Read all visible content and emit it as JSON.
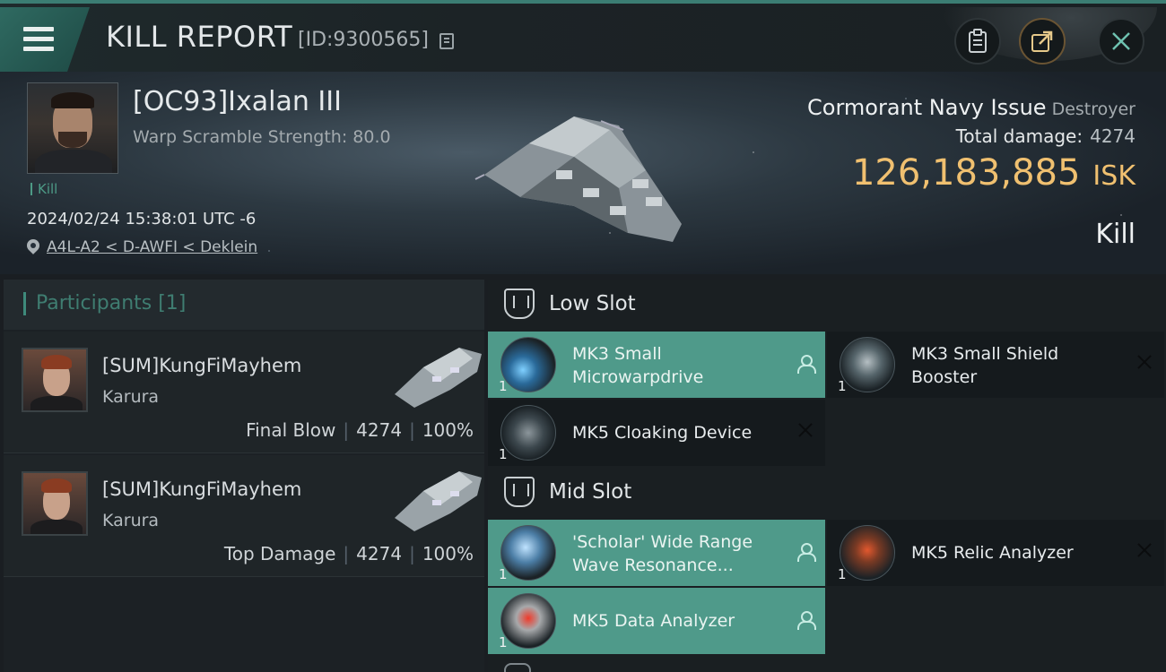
{
  "header": {
    "title": "KILL REPORT",
    "report_id": "[ID:9300565]",
    "buttons": [
      "clipboard-icon",
      "share-icon",
      "close-icon"
    ]
  },
  "victim": {
    "name": "[OC93]Ixalan III",
    "warp_scramble": "Warp Scramble Strength: 80.0",
    "tag": "Kill",
    "time": "2024/02/24 15:38:01 UTC -6",
    "location": "A4L-A2 < D-AWFI < Deklein",
    "ship_name": "Cormorant Navy Issue",
    "ship_class": "Destroyer",
    "total_damage_label": "Total damage:",
    "total_damage_value": "4274",
    "isk_value": "126,183,885",
    "isk_unit": "ISK",
    "result": "Kill"
  },
  "participants": {
    "title": "Participants [1]",
    "rows": [
      {
        "name": "[SUM]KungFiMayhem",
        "ship": "Karura",
        "role": "Final Blow",
        "damage": "4274",
        "percent": "100%"
      },
      {
        "name": "[SUM]KungFiMayhem",
        "ship": "Karura",
        "role": "Top Damage",
        "damage": "4274",
        "percent": "100%"
      }
    ]
  },
  "fitting": {
    "low_slot": {
      "title": "Low Slot",
      "modules": [
        {
          "name": "MK3 Small Microwarpdrive",
          "qty": "1",
          "status": "dropped"
        },
        {
          "name": "MK3 Small Shield Booster",
          "qty": "1",
          "status": "destroyed"
        },
        {
          "name": "MK5 Cloaking Device",
          "qty": "1",
          "status": "destroyed"
        }
      ]
    },
    "mid_slot": {
      "title": "Mid Slot",
      "modules": [
        {
          "name": "'Scholar' Wide Range Wave Resonance...",
          "qty": "1",
          "status": "dropped"
        },
        {
          "name": "MK5 Relic Analyzer",
          "qty": "1",
          "status": "destroyed"
        },
        {
          "name": "MK5 Data Analyzer",
          "qty": "1",
          "status": "dropped"
        }
      ]
    }
  },
  "colors": {
    "accent": "#4f9a8a",
    "isk": "#f0c070",
    "background": "#1a1e22"
  }
}
